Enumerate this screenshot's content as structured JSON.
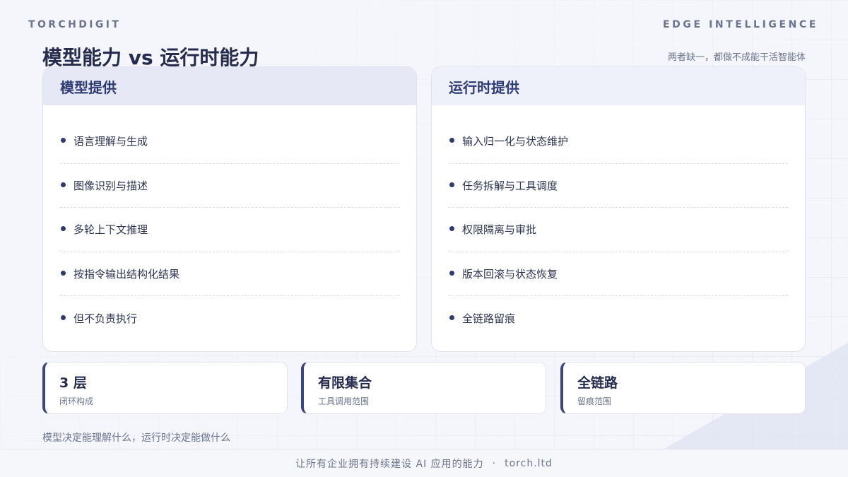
{
  "header": {
    "brand": "TORCHDIGIT",
    "tagline": "EDGE INTELLIGENCE",
    "title": "模型能力 vs 运行时能力",
    "subtitle": "两者缺一，都做不成能干活智能体"
  },
  "panels": [
    {
      "title": "模型提供",
      "items": [
        "语言理解与生成",
        "图像识别与描述",
        "多轮上下文推理",
        "按指令输出结构化结果",
        "但不负责执行"
      ]
    },
    {
      "title": "运行时提供",
      "items": [
        "输入归一化与状态维护",
        "任务拆解与工具调度",
        "权限隔离与审批",
        "版本回滚与状态恢复",
        "全链路留痕"
      ]
    }
  ],
  "stats": [
    {
      "value": "3 层",
      "label": "闭环构成"
    },
    {
      "value": "有限集合",
      "label": "工具调用范围"
    },
    {
      "value": "全链路",
      "label": "留痕范围"
    }
  ],
  "note": "模型决定能理解什么，运行时决定能做什么",
  "footer": {
    "text": "让所有企业拥有持续建设 AI 应用的能力",
    "separator": "·",
    "site": "torch.ltd"
  }
}
